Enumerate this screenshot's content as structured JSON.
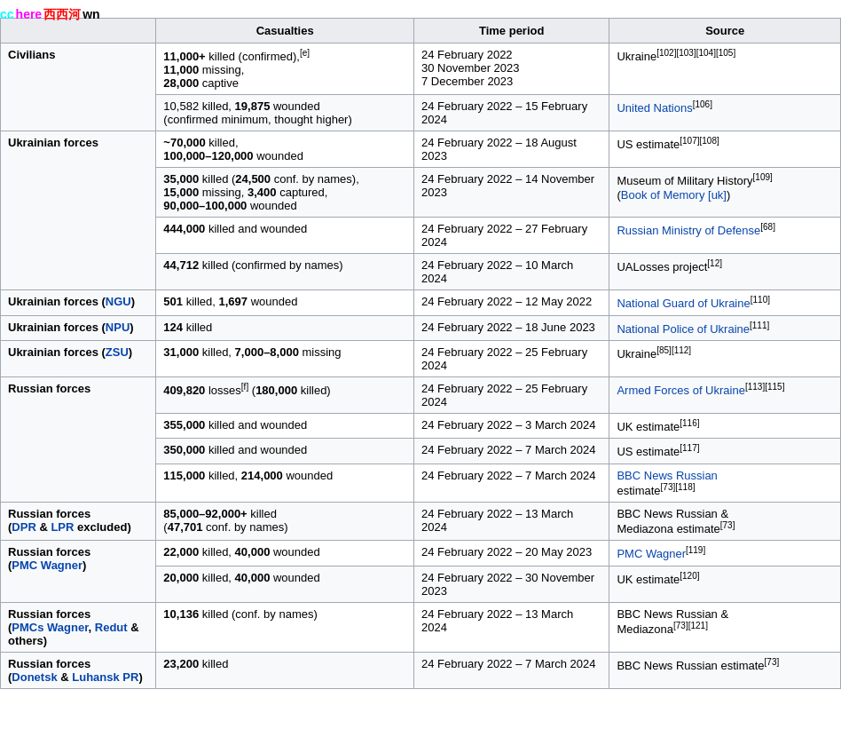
{
  "watermark": {
    "cc": "cc",
    "here": "here",
    "cn": "西西河",
    "wn": " wn"
  },
  "header": {
    "col1": "Casualties",
    "col2": "Time period",
    "col3": "Source"
  },
  "rows": [
    {
      "rowHeader": "Civilians",
      "rowSpan": 2,
      "subrows": [
        {
          "casualties": "11,000+ killed (confirmed),[e]\n11,000 missing,\n28,000 captive",
          "timePeriod": "24 February 2022\n30 November 2023\n7 December 2023",
          "source": "Ukraine[102][103][104][105]",
          "sourceLink": "",
          "bg": "white"
        },
        {
          "casualties": "10,582 killed, 19,875 wounded\n(confirmed minimum, thought higher)",
          "timePeriod": "24 February 2022 – 15 February 2024",
          "source": "United Nations[106]",
          "sourceLink": "United Nations",
          "bg": "alt"
        }
      ]
    },
    {
      "rowHeader": "Ukrainian forces",
      "rowSpan": 4,
      "subrows": [
        {
          "casualties": "~70,000 killed,\n100,000–120,000 wounded",
          "timePeriod": "24 February 2022 – 18 August 2023",
          "source": "US estimate[107][108]",
          "bg": "white"
        },
        {
          "casualties": "35,000 killed (24,500 conf. by names),\n15,000 missing, 3,400 captured,\n90,000–100,000 wounded",
          "timePeriod": "24 February 2022 – 14 November 2023",
          "source": "Museum of Military History[109]\n(Book of Memory [uk])",
          "sourceLink": "Museum of Military History",
          "bg": "alt"
        },
        {
          "casualties": "444,000 killed and wounded",
          "timePeriod": "24 February 2022 – 27 February 2024",
          "source": "Russian Ministry of Defense[68]",
          "sourceLink": "Russian Ministry of Defense",
          "bg": "white"
        },
        {
          "casualties": "44,712 killed (confirmed by names)",
          "timePeriod": "24 February 2022 – 10 March 2024",
          "source": "UALosses project[12]",
          "bg": "alt"
        }
      ]
    }
  ],
  "single_rows": [
    {
      "header": "Ukrainian forces (NGU)",
      "headerLink": "NGU",
      "casualties": "501 killed, 1,697 wounded",
      "timePeriod": "24 February 2022 – 12 May 2022",
      "source": "National Guard of Ukraine[110]",
      "sourceLink": "National Guard of Ukraine",
      "bg": "white"
    },
    {
      "header": "Ukrainian forces (NPU)",
      "headerLink": "NPU",
      "casualties": "124 killed",
      "timePeriod": "24 February 2022 – 18 June 2023",
      "source": "National Police of Ukraine[111]",
      "sourceLink": "National Police of Ukraine",
      "bg": "alt"
    },
    {
      "header": "Ukrainian forces (ZSU)",
      "headerLink": "ZSU",
      "casualties": "31,000 killed, 7,000–8,000 missing",
      "timePeriod": "24 February 2022 – 25 February 2024",
      "source": "Ukraine[85][112]",
      "bg": "white"
    }
  ],
  "russian_forces": {
    "header": "Russian forces",
    "subrows": [
      {
        "casualties": "409,820 losses[f] (180,000 killed)",
        "timePeriod": "24 February 2022 – 25 February 2024",
        "source": "Armed Forces of Ukraine[113][115]",
        "sourceLink": "Armed Forces of Ukraine",
        "bg": "alt"
      },
      {
        "casualties": "355,000 killed and wounded",
        "timePeriod": "24 February 2022 – 3 March 2024",
        "source": "UK estimate[116]",
        "bg": "white"
      },
      {
        "casualties": "350,000 killed and wounded",
        "timePeriod": "24 February 2022 – 7 March 2024",
        "source": "US estimate[117]",
        "bg": "alt"
      },
      {
        "casualties": "115,000 killed, 214,000 wounded",
        "timePeriod": "24 February 2022 – 7 March 2024",
        "source": "BBC News Russian estimate[73][118]",
        "sourceLink": "BBC News Russian",
        "bg": "white"
      }
    ]
  },
  "rf_dpr": {
    "header": "Russian forces\n(DPR & LPR excluded)",
    "headerLinks": [
      "DPR",
      "LPR"
    ],
    "casualties": "85,000–92,000+ killed\n(47,701 conf. by names)",
    "timePeriod": "24 February 2022 – 13 March 2024",
    "source": "BBC News Russian &\nMediazona estimate[73]"
  },
  "rf_pmc_rows": [
    {
      "header": "Russian forces\n(PMC Wagner)",
      "headerLink": "PMC Wagner",
      "subrows": [
        {
          "casualties": "22,000 killed, 40,000 wounded",
          "timePeriod": "24 February 2022 – 20 May 2023",
          "source": "PMC Wagner[119]",
          "sourceLink": "PMC Wagner",
          "bg": "alt"
        },
        {
          "casualties": "20,000 killed, 40,000 wounded",
          "timePeriod": "24 February 2022 – 30 November 2023",
          "source": "UK estimate[120]",
          "bg": "white"
        }
      ]
    }
  ],
  "rf_pmcs_redut": {
    "header": "Russian forces\n(PMCs Wagner, Redut &\nothers)",
    "headerLinks": [
      "PMCs Wagner",
      "Redut"
    ],
    "casualties": "10,136 killed (conf. by names)",
    "timePeriod": "24 February 2022 – 13 March 2024",
    "source": "BBC News Russian &\nMediazona[73][121]"
  },
  "rf_donetsk": {
    "header": "Russian forces\n(Donetsk & Luhansk PR)",
    "headerLinks": [
      "Donetsk",
      "Luhansk PR"
    ],
    "casualties": "23,200 killed",
    "timePeriod": "24 February 2022 – 7 March 2024",
    "source": "BBC News Russian estimate[73]"
  }
}
